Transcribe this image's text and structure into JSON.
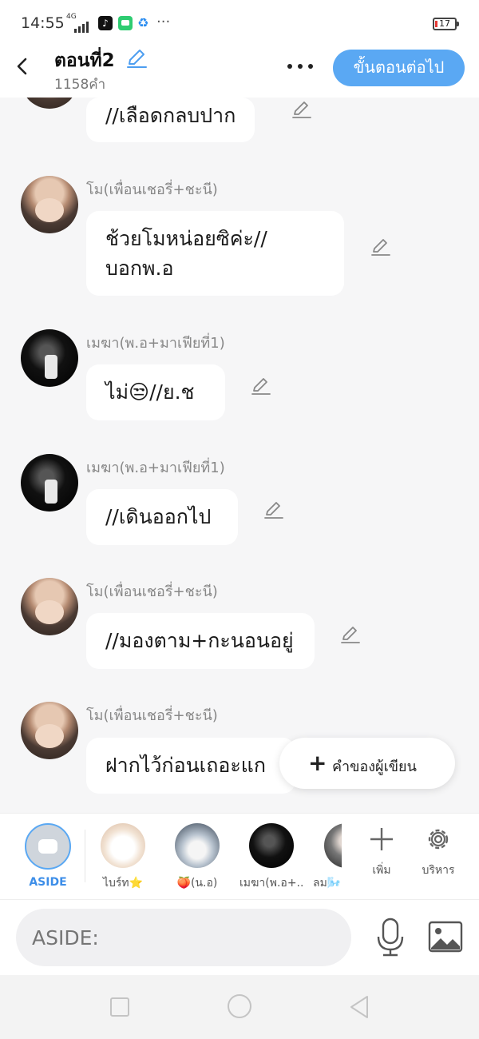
{
  "status_bar": {
    "time": "14:55",
    "network": "4G",
    "battery": "17"
  },
  "header": {
    "title": "ตอนที่2",
    "word_count": "1158คำ",
    "next_button": "ขั้นตอนต่อไป"
  },
  "messages": [
    {
      "sender": "",
      "text": "//เลือดกลบปาก",
      "avatar": "mo"
    },
    {
      "sender": "โม(เพื่อนเชอรี่+ชะนี)",
      "text": "ช้วยโมหน่อยซิค่ะ//\nบอกพ.อ",
      "avatar": "mo"
    },
    {
      "sender": "เมฆา(พ.อ+มาเฟียที่1)",
      "text": "ไม่😒//ย.ช",
      "avatar": "mek"
    },
    {
      "sender": "เมฆา(พ.อ+มาเฟียที่1)",
      "text": "//เดินออกไป",
      "avatar": "mek"
    },
    {
      "sender": "โม(เพื่อนเชอรี่+ชะนี)",
      "text": "//มองตาม+กะนอนอยู่",
      "avatar": "mo"
    },
    {
      "sender": "โม(เพื่อนเชอรี่+ชะนี)",
      "text": "ฝากไว้ก่อนเถอะแก",
      "avatar": "mo"
    }
  ],
  "fab": {
    "label": "คำของผู้เขียน"
  },
  "characters": {
    "aside_label": "ASIDE",
    "items": [
      "ไบร์ท⭐",
      "🍑(น.อ)",
      "เมฆา(พ.อ+...",
      "ลม🌬️"
    ],
    "add_label": "เพิ่ม",
    "manage_label": "บริหาร"
  },
  "input": {
    "placeholder": "ASIDE:"
  },
  "colors": {
    "accent": "#5aa8f3",
    "background": "#f6f6f7"
  }
}
